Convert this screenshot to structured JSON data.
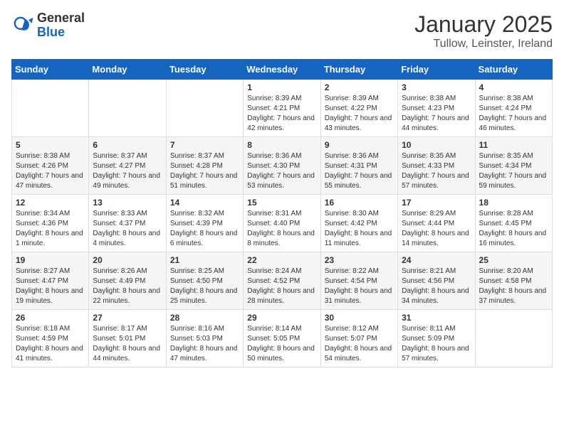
{
  "logo": {
    "general": "General",
    "blue": "Blue"
  },
  "title": "January 2025",
  "location": "Tullow, Leinster, Ireland",
  "days_of_week": [
    "Sunday",
    "Monday",
    "Tuesday",
    "Wednesday",
    "Thursday",
    "Friday",
    "Saturday"
  ],
  "weeks": [
    [
      {
        "day": "",
        "info": ""
      },
      {
        "day": "",
        "info": ""
      },
      {
        "day": "",
        "info": ""
      },
      {
        "day": "1",
        "info": "Sunrise: 8:39 AM\nSunset: 4:21 PM\nDaylight: 7 hours and 42 minutes."
      },
      {
        "day": "2",
        "info": "Sunrise: 8:39 AM\nSunset: 4:22 PM\nDaylight: 7 hours and 43 minutes."
      },
      {
        "day": "3",
        "info": "Sunrise: 8:38 AM\nSunset: 4:23 PM\nDaylight: 7 hours and 44 minutes."
      },
      {
        "day": "4",
        "info": "Sunrise: 8:38 AM\nSunset: 4:24 PM\nDaylight: 7 hours and 46 minutes."
      }
    ],
    [
      {
        "day": "5",
        "info": "Sunrise: 8:38 AM\nSunset: 4:26 PM\nDaylight: 7 hours and 47 minutes."
      },
      {
        "day": "6",
        "info": "Sunrise: 8:37 AM\nSunset: 4:27 PM\nDaylight: 7 hours and 49 minutes."
      },
      {
        "day": "7",
        "info": "Sunrise: 8:37 AM\nSunset: 4:28 PM\nDaylight: 7 hours and 51 minutes."
      },
      {
        "day": "8",
        "info": "Sunrise: 8:36 AM\nSunset: 4:30 PM\nDaylight: 7 hours and 53 minutes."
      },
      {
        "day": "9",
        "info": "Sunrise: 8:36 AM\nSunset: 4:31 PM\nDaylight: 7 hours and 55 minutes."
      },
      {
        "day": "10",
        "info": "Sunrise: 8:35 AM\nSunset: 4:33 PM\nDaylight: 7 hours and 57 minutes."
      },
      {
        "day": "11",
        "info": "Sunrise: 8:35 AM\nSunset: 4:34 PM\nDaylight: 7 hours and 59 minutes."
      }
    ],
    [
      {
        "day": "12",
        "info": "Sunrise: 8:34 AM\nSunset: 4:36 PM\nDaylight: 8 hours and 1 minute."
      },
      {
        "day": "13",
        "info": "Sunrise: 8:33 AM\nSunset: 4:37 PM\nDaylight: 8 hours and 4 minutes."
      },
      {
        "day": "14",
        "info": "Sunrise: 8:32 AM\nSunset: 4:39 PM\nDaylight: 8 hours and 6 minutes."
      },
      {
        "day": "15",
        "info": "Sunrise: 8:31 AM\nSunset: 4:40 PM\nDaylight: 8 hours and 8 minutes."
      },
      {
        "day": "16",
        "info": "Sunrise: 8:30 AM\nSunset: 4:42 PM\nDaylight: 8 hours and 11 minutes."
      },
      {
        "day": "17",
        "info": "Sunrise: 8:29 AM\nSunset: 4:44 PM\nDaylight: 8 hours and 14 minutes."
      },
      {
        "day": "18",
        "info": "Sunrise: 8:28 AM\nSunset: 4:45 PM\nDaylight: 8 hours and 16 minutes."
      }
    ],
    [
      {
        "day": "19",
        "info": "Sunrise: 8:27 AM\nSunset: 4:47 PM\nDaylight: 8 hours and 19 minutes."
      },
      {
        "day": "20",
        "info": "Sunrise: 8:26 AM\nSunset: 4:49 PM\nDaylight: 8 hours and 22 minutes."
      },
      {
        "day": "21",
        "info": "Sunrise: 8:25 AM\nSunset: 4:50 PM\nDaylight: 8 hours and 25 minutes."
      },
      {
        "day": "22",
        "info": "Sunrise: 8:24 AM\nSunset: 4:52 PM\nDaylight: 8 hours and 28 minutes."
      },
      {
        "day": "23",
        "info": "Sunrise: 8:22 AM\nSunset: 4:54 PM\nDaylight: 8 hours and 31 minutes."
      },
      {
        "day": "24",
        "info": "Sunrise: 8:21 AM\nSunset: 4:56 PM\nDaylight: 8 hours and 34 minutes."
      },
      {
        "day": "25",
        "info": "Sunrise: 8:20 AM\nSunset: 4:58 PM\nDaylight: 8 hours and 37 minutes."
      }
    ],
    [
      {
        "day": "26",
        "info": "Sunrise: 8:18 AM\nSunset: 4:59 PM\nDaylight: 8 hours and 41 minutes."
      },
      {
        "day": "27",
        "info": "Sunrise: 8:17 AM\nSunset: 5:01 PM\nDaylight: 8 hours and 44 minutes."
      },
      {
        "day": "28",
        "info": "Sunrise: 8:16 AM\nSunset: 5:03 PM\nDaylight: 8 hours and 47 minutes."
      },
      {
        "day": "29",
        "info": "Sunrise: 8:14 AM\nSunset: 5:05 PM\nDaylight: 8 hours and 50 minutes."
      },
      {
        "day": "30",
        "info": "Sunrise: 8:12 AM\nSunset: 5:07 PM\nDaylight: 8 hours and 54 minutes."
      },
      {
        "day": "31",
        "info": "Sunrise: 8:11 AM\nSunset: 5:09 PM\nDaylight: 8 hours and 57 minutes."
      },
      {
        "day": "",
        "info": ""
      }
    ]
  ]
}
